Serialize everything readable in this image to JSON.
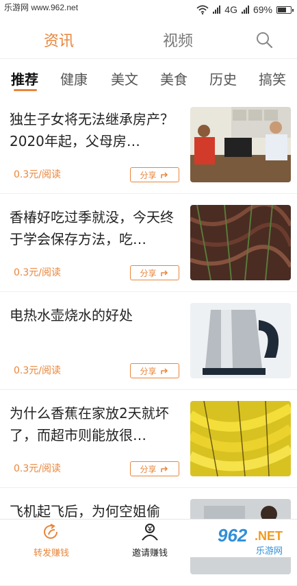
{
  "status_bar": {
    "site_watermark": "乐游网 www.962.net",
    "network": "4G",
    "battery": "69%",
    "battery_level": 0.69
  },
  "top_tabs": [
    {
      "label": "资讯",
      "active": true
    },
    {
      "label": "视频",
      "active": false
    }
  ],
  "categories": [
    "推荐",
    "健康",
    "美文",
    "美食",
    "历史",
    "搞笑"
  ],
  "feed": [
    {
      "title": "独生子女将无法继承房产？2020年起，父母房…",
      "reward": "0.3元/阅读",
      "share": "分享",
      "thumb": "office-desk-photo"
    },
    {
      "title": "香椿好吃过季就没，今天终于学会保存方法，吃…",
      "reward": "0.3元/阅读",
      "share": "分享",
      "thumb": "chinese-toon-photo"
    },
    {
      "title": "电热水壶烧水的好处",
      "reward": "0.3元/阅读",
      "share": "分享",
      "thumb": "electric-kettle-photo"
    },
    {
      "title": "为什么香蕉在家放2天就坏了，而超市则能放很…",
      "reward": "0.3元/阅读",
      "share": "分享",
      "thumb": "bananas-photo"
    },
    {
      "title": "飞机起飞后，为何空姐偷",
      "thumb": "flight-attendant-photo"
    }
  ],
  "bottom_nav": [
    {
      "label": "转发赚钱",
      "icon": "share-earn-icon",
      "active": true
    },
    {
      "label": "邀请赚钱",
      "icon": "invite-earn-icon",
      "active": false
    }
  ],
  "corner_watermark": {
    "brand": "962",
    "suffix": "NET",
    "sub": "乐游网"
  },
  "colors": {
    "accent": "#e8853a"
  }
}
